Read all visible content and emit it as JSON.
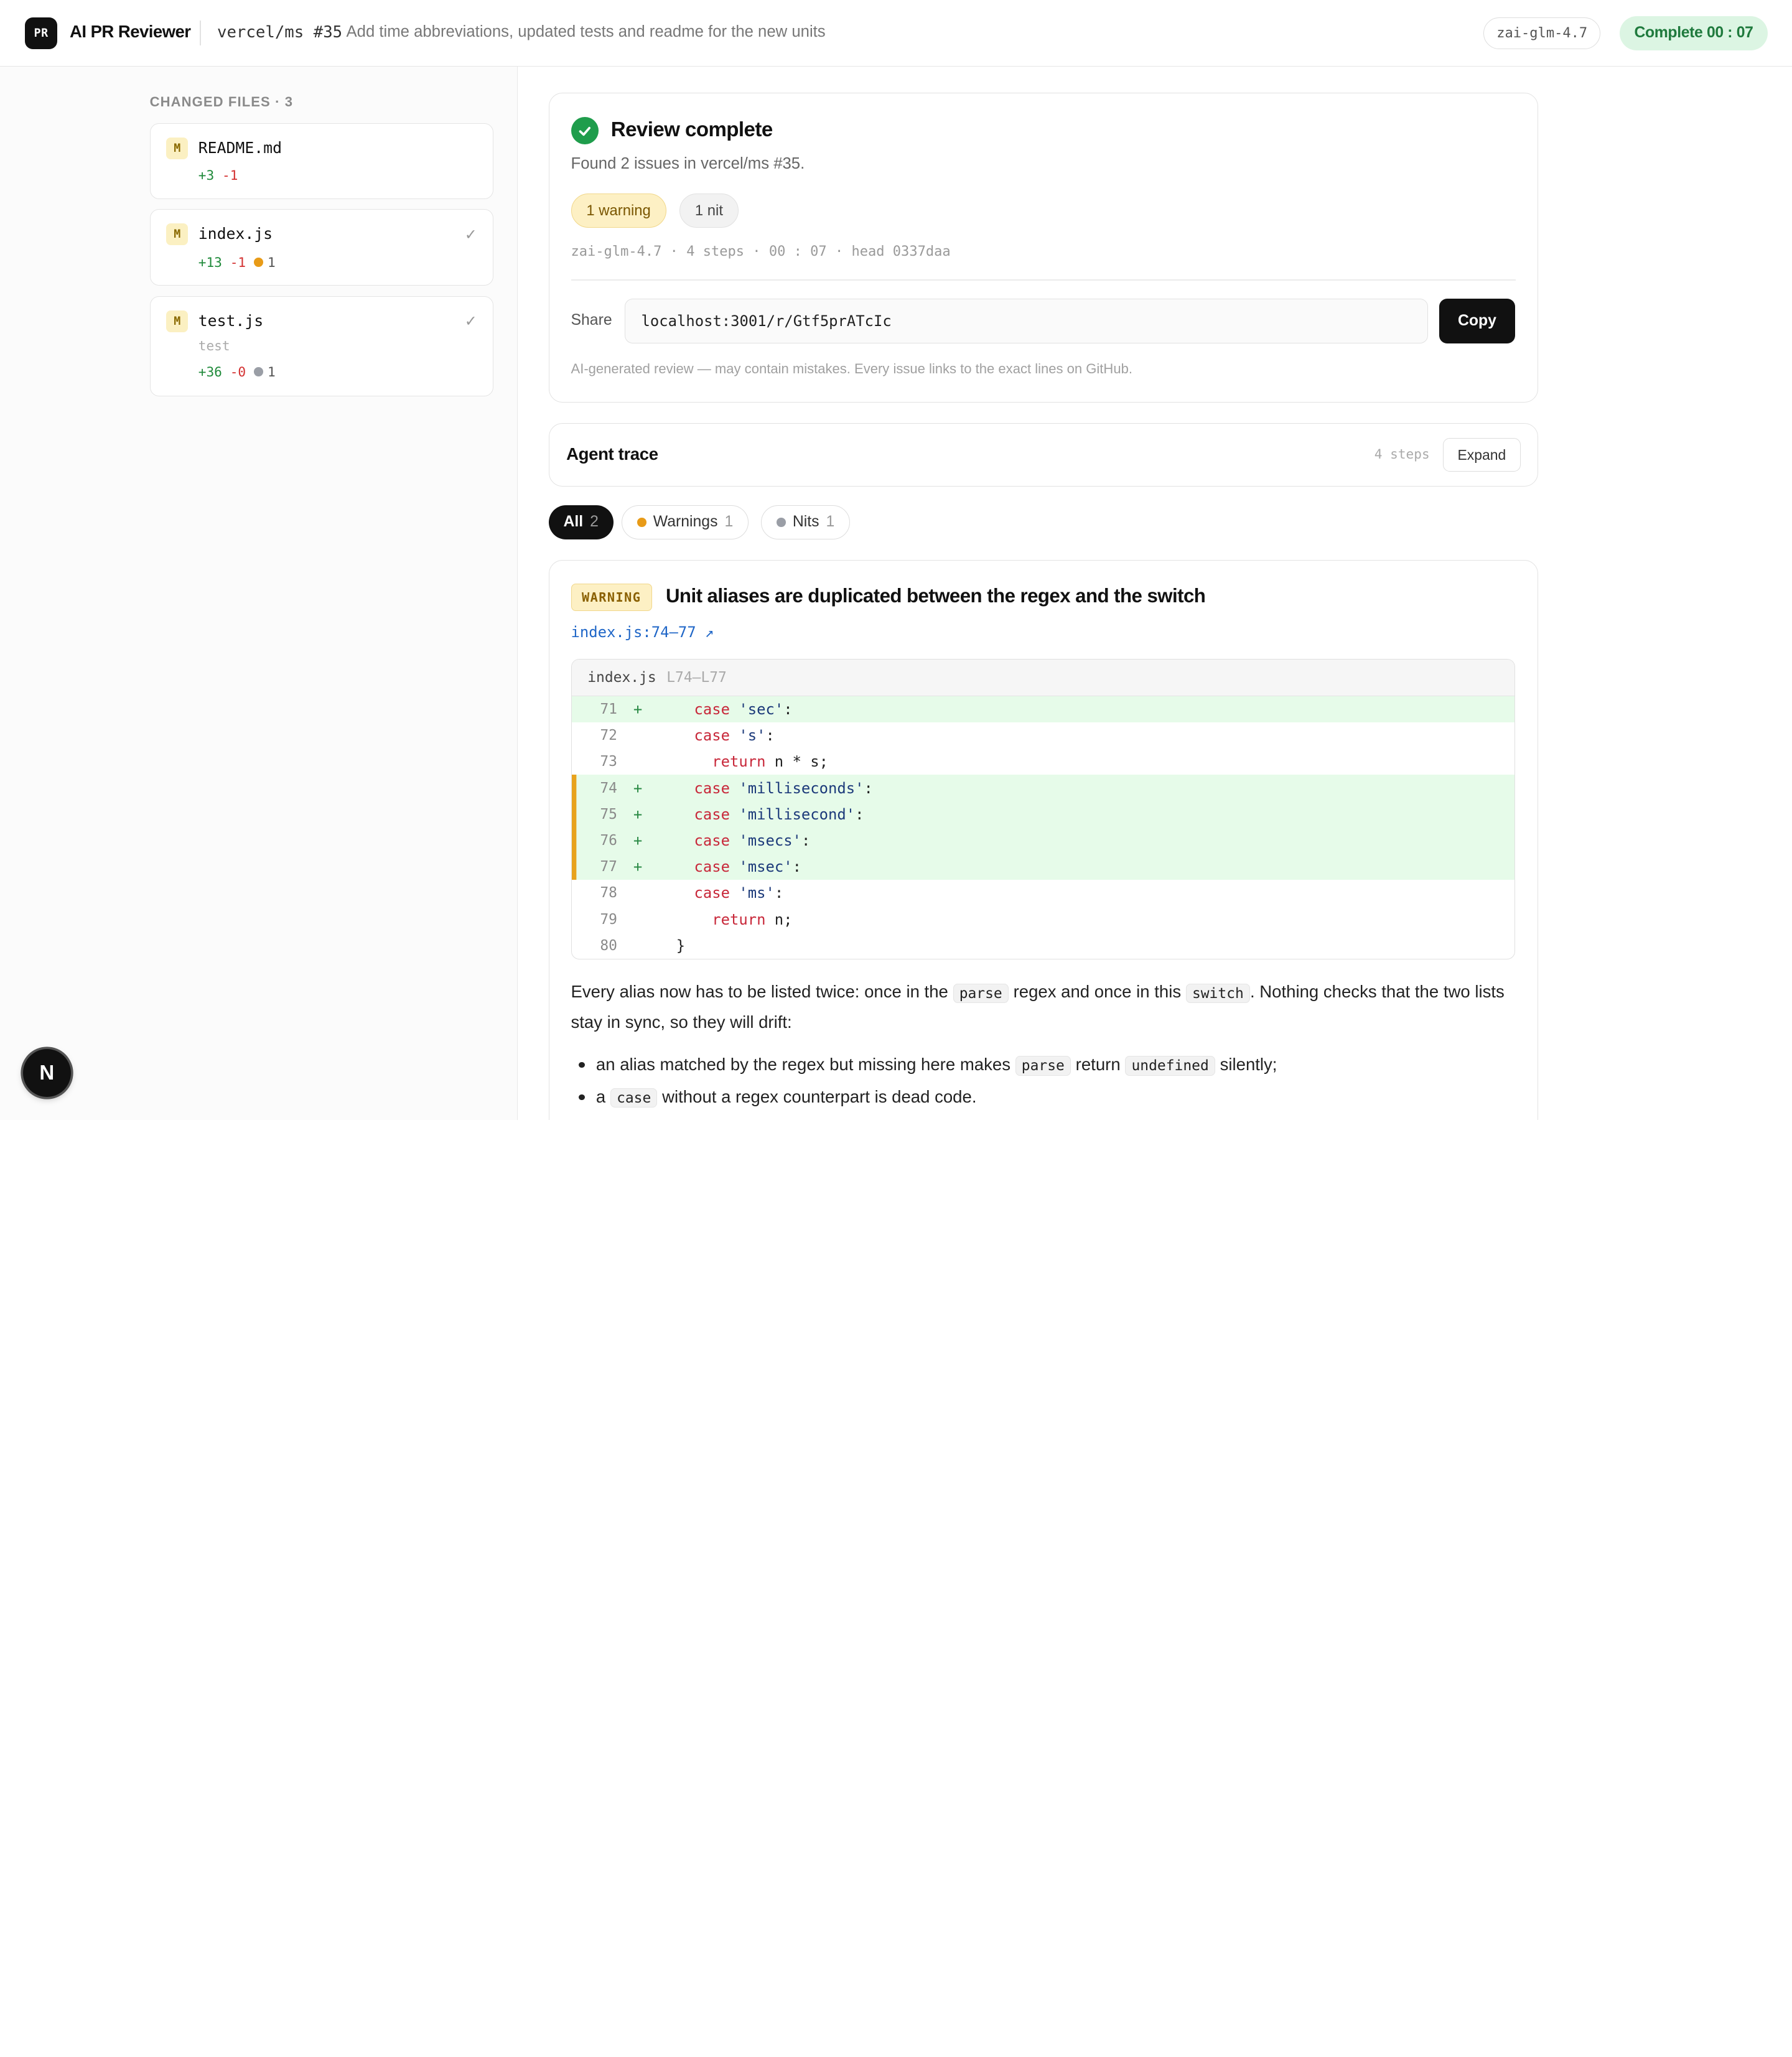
{
  "header": {
    "logo_text": "PR",
    "app_title": "AI PR Reviewer",
    "repo": "vercel/ms #35",
    "pr_title": "Add time abbreviations, updated tests and readme for the new units",
    "model": "zai-glm-4.7",
    "status": "Complete 00 : 07",
    "status_color": "#1f7a3d"
  },
  "sidebar": {
    "heading": "CHANGED FILES · 3",
    "files": [
      {
        "badge": "M",
        "name": "README.md",
        "sub": "",
        "additions": "+3",
        "deletions": "-1",
        "checked": false,
        "issue_count": "",
        "issue_kind": ""
      },
      {
        "badge": "M",
        "name": "index.js",
        "sub": "",
        "additions": "+13",
        "deletions": "-1",
        "checked": true,
        "check": "✓",
        "issue_count": "1",
        "issue_kind": "warning"
      },
      {
        "badge": "M",
        "name": "test.js",
        "sub": "test",
        "additions": "+36",
        "deletions": "-0",
        "checked": true,
        "check": "✓",
        "issue_count": "1",
        "issue_kind": "nit"
      }
    ]
  },
  "summary": {
    "title": "Review complete",
    "subtitle": "Found 2 issues in vercel/ms #35.",
    "warning_chip": "1 warning",
    "nit_chip": "1 nit",
    "meta": "zai-glm-4.7 · 4 steps · 00 : 07 · head 0337daa",
    "share_label": "Share",
    "share_url": "localhost:3001/r/Gtf5prATcIc",
    "copy_label": "Copy",
    "disclaimer": "AI-generated review — may contain mistakes. Every issue links to the exact lines on GitHub."
  },
  "trace": {
    "title": "Agent trace",
    "steps": "4 steps",
    "expand_label": "Expand"
  },
  "filters": {
    "all_label": "All",
    "all_count": "2",
    "warnings_label": "Warnings",
    "warnings_count": "1",
    "nits_label": "Nits",
    "nits_count": "1"
  },
  "issue": {
    "severity": "WARNING",
    "title": "Unit aliases are duplicated between the regex and the switch",
    "location": "index.js:74–77 ↗",
    "code_file": "index.js",
    "code_range": "L74–L77",
    "code_lines": [
      {
        "n": "71",
        "sign": "+",
        "indent": "    ",
        "kw": "case",
        "rest": " 'sec':",
        "added": true,
        "marked": false
      },
      {
        "n": "72",
        "sign": "",
        "indent": "    ",
        "kw": "case",
        "rest": " 's':",
        "added": false,
        "marked": false
      },
      {
        "n": "73",
        "sign": "",
        "indent": "      ",
        "kw": "return",
        "rest": " n * s;",
        "added": false,
        "marked": false
      },
      {
        "n": "74",
        "sign": "+",
        "indent": "    ",
        "kw": "case",
        "rest": " 'milliseconds':",
        "added": true,
        "marked": true
      },
      {
        "n": "75",
        "sign": "+",
        "indent": "    ",
        "kw": "case",
        "rest": " 'millisecond':",
        "added": true,
        "marked": true
      },
      {
        "n": "76",
        "sign": "+",
        "indent": "    ",
        "kw": "case",
        "rest": " 'msecs':",
        "added": true,
        "marked": true
      },
      {
        "n": "77",
        "sign": "+",
        "indent": "    ",
        "kw": "case",
        "rest": " 'msec':",
        "added": true,
        "marked": true
      },
      {
        "n": "78",
        "sign": "",
        "indent": "    ",
        "kw": "case",
        "rest": " 'ms':",
        "added": false,
        "marked": false
      },
      {
        "n": "79",
        "sign": "",
        "indent": "      ",
        "kw": "return",
        "rest": " n;",
        "added": false,
        "marked": false
      },
      {
        "n": "80",
        "sign": "",
        "indent": "  ",
        "kw": "",
        "rest": "}",
        "added": false,
        "marked": false
      }
    ],
    "body": {
      "p1_a": "Every alias now has to be listed twice: once in the ",
      "p1_code1": "parse",
      "p1_b": " regex and once in this ",
      "p1_code2": "switch",
      "p1_c": ". Nothing checks that the two lists stay in sync, so they will drift:",
      "b1_a": "an alias matched by the regex but missing here makes ",
      "b1_code1": "parse",
      "b1_b": " return ",
      "b1_code2": "undefined",
      "b1_c": " silently;",
      "b2_a": "a ",
      "b2_code": "case",
      "b2_b": " without a regex counterpart is dead code."
    }
  },
  "fab": {
    "label": "N"
  }
}
